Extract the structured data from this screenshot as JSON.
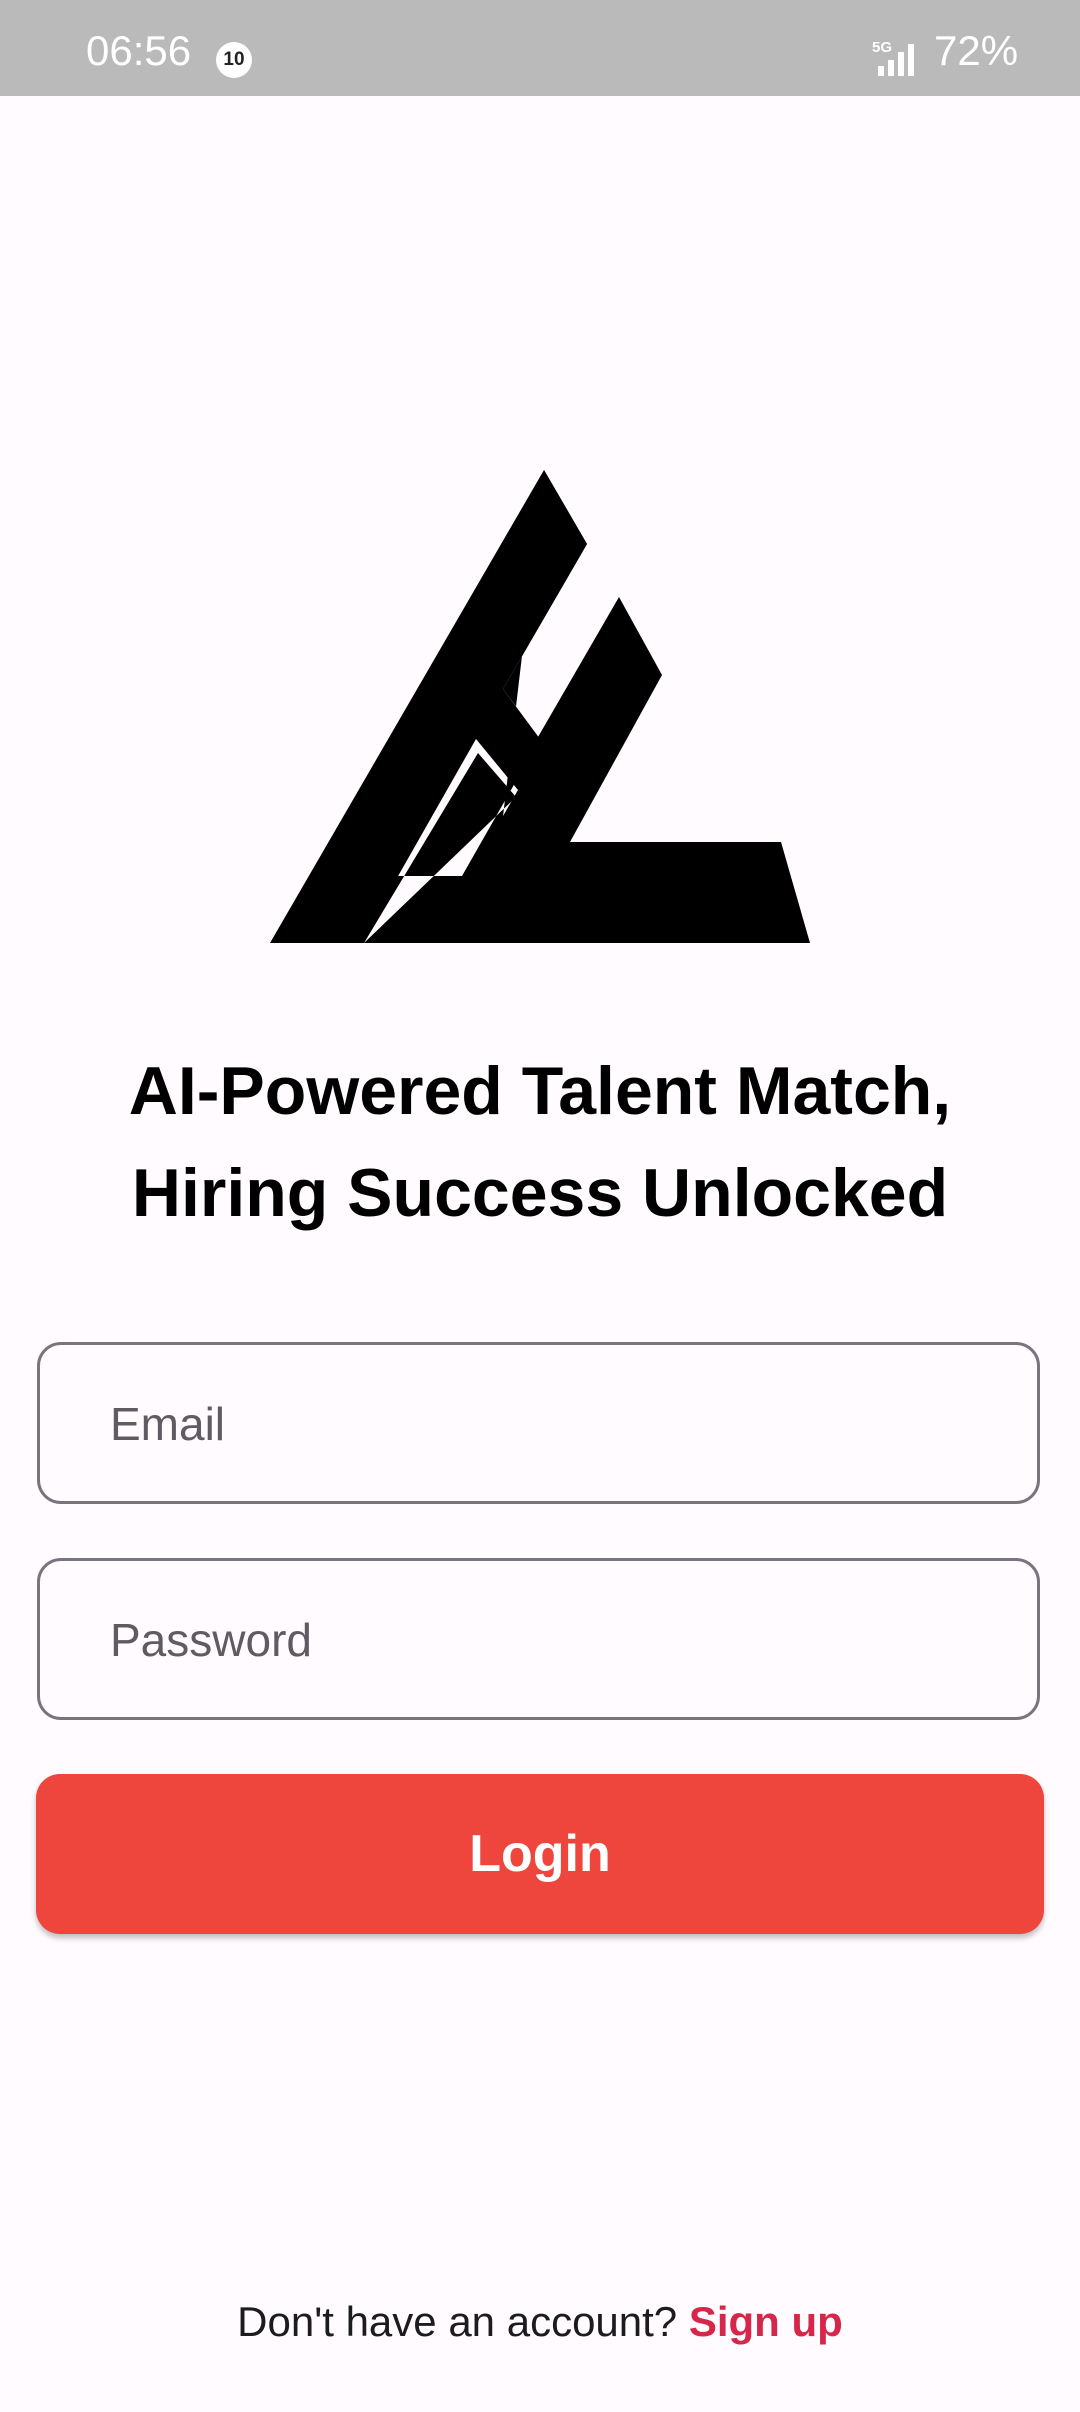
{
  "status_bar": {
    "time": "06:56",
    "notification_count": "10",
    "network": "5G",
    "battery": "72%"
  },
  "hero": {
    "tagline_line1": "AI-Powered Talent Match,",
    "tagline_line2": "Hiring Success Unlocked"
  },
  "form": {
    "email_placeholder": "Email",
    "email_value": "",
    "password_placeholder": "Password",
    "password_value": "",
    "login_label": "Login"
  },
  "footer": {
    "prompt": "Don't have an account?",
    "signup_label": "Sign up"
  },
  "colors": {
    "status_bar": "#bbbabb",
    "background": "#fffbfe",
    "primary_button": "#ee453d",
    "link": "#d6264a",
    "field_border": "#79747e"
  },
  "icons": {
    "logo": "hl-triangle-logo",
    "signal": "signal-strength-icon"
  }
}
